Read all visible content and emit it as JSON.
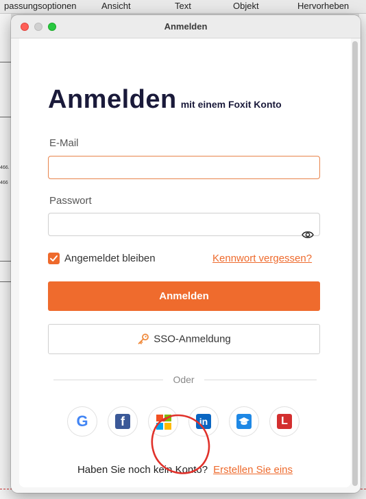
{
  "background_app": {
    "menu": [
      "passungsoptionen",
      "Ansicht",
      "Text",
      "Objekt",
      "Hervorheben"
    ],
    "sidebar_numbers": [
      "466.",
      "466"
    ]
  },
  "window": {
    "title": "Anmelden"
  },
  "form": {
    "heading": "Anmelden",
    "subheading": "mit einem Foxit Konto",
    "email_label": "E-Mail",
    "email_value": "",
    "password_label": "Passwort",
    "password_value": "",
    "remember_label": "Angemeldet bleiben",
    "remember_checked": true,
    "forgot_link": "Kennwort vergessen?",
    "submit_label": "Anmelden",
    "sso_label": "SSO-Anmeldung",
    "divider_text": "Oder"
  },
  "social": [
    {
      "name": "google",
      "icon": "google-icon",
      "glyph": "G",
      "color": "#4285F4"
    },
    {
      "name": "facebook",
      "icon": "facebook-icon",
      "glyph": "f",
      "color": "#3b5998"
    },
    {
      "name": "microsoft",
      "icon": "microsoft-icon",
      "glyph": "",
      "color": "#f25022"
    },
    {
      "name": "linkedin",
      "icon": "linkedin-icon",
      "glyph": "in",
      "color": "#0a66c2"
    },
    {
      "name": "education",
      "icon": "graduation-cap-icon",
      "glyph": "",
      "color": "#1e88e5"
    },
    {
      "name": "l-provider",
      "icon": "letter-l-icon",
      "glyph": "L",
      "color": "#d32f2f"
    }
  ],
  "signup": {
    "prompt": "Haben Sie noch kein Konto?",
    "link": "Erstellen Sie eins"
  },
  "colors": {
    "accent": "#ef6b2d",
    "annotation": "#e0312a"
  }
}
